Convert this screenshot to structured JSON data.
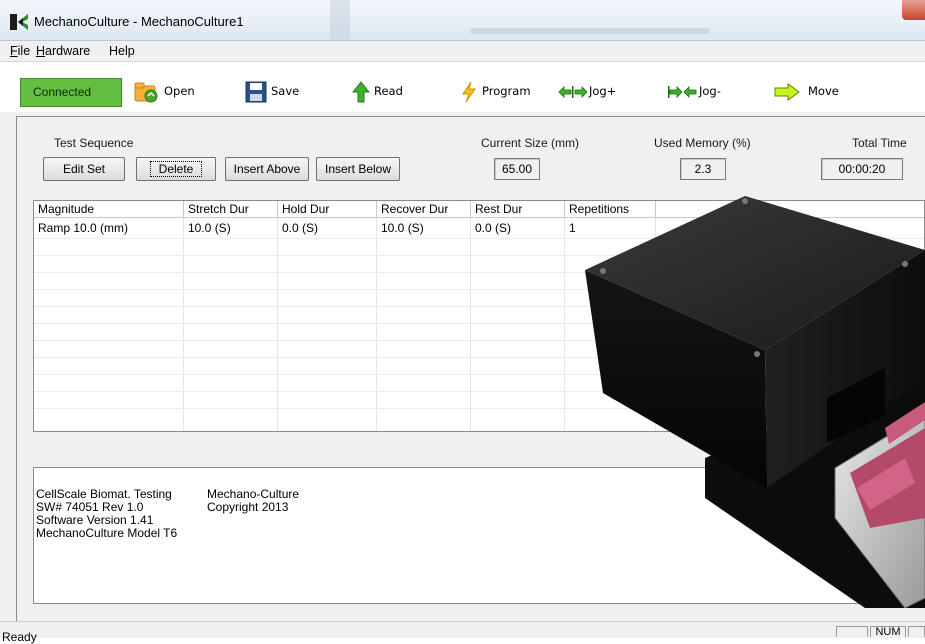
{
  "window": {
    "title": "MechanoCulture - MechanoCulture1"
  },
  "menu": [
    {
      "label": "File"
    },
    {
      "label": "Hardware"
    },
    {
      "label": "Help"
    }
  ],
  "toolbar": {
    "connected_label": "Connected",
    "open_label": "Open",
    "save_label": "Save",
    "read_label": "Read",
    "program_label": "Program",
    "jog_plus_label": "Jog+",
    "jog_minus_label": "Jog-",
    "move_label": "Move",
    "connected_color": "#63bf3f"
  },
  "sequence": {
    "title": "Test Sequence",
    "buttons": {
      "edit_set": "Edit Set",
      "delete": "Delete",
      "insert_above": "Insert Above",
      "insert_below": "Insert Below"
    }
  },
  "stats": {
    "current_size_label": "Current Size (mm)",
    "current_size_value": "65.00",
    "used_memory_label": "Used Memory (%)",
    "used_memory_value": "2.3",
    "total_time_label": "Total Time",
    "total_time_value": "00:00:20"
  },
  "table": {
    "columns": [
      "Magnitude",
      "Stretch Dur",
      "Hold Dur",
      "Recover Dur",
      "Rest Dur",
      "Repetitions"
    ],
    "rows": [
      [
        "Ramp 10.0 (mm)",
        "10.0 (S)",
        "0.0 (S)",
        "10.0 (S)",
        "0.0 (S)",
        "1"
      ]
    ]
  },
  "info": {
    "col1": [
      "CellScale Biomat. Testing",
      "SW# 74051  Rev 1.0",
      "Software Version 1.41",
      "MechanoCulture Model T6"
    ],
    "col2": [
      "Mechano-Culture",
      "Copyright 2013"
    ]
  },
  "statusbar": {
    "status_text": "Ready",
    "num_indicator": "NUM"
  }
}
